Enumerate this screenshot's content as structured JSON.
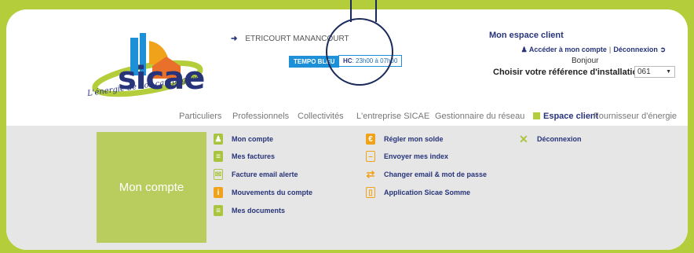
{
  "logo": {
    "brand": "sicae",
    "tagline": "L'énergie de nos campagnes"
  },
  "header": {
    "location": "ETRICOURT MANANCOURT",
    "tempo_badge": "TEMPO BLEU",
    "hc_label": "HC",
    "hc_hours": ": 23h00 à 07h00",
    "espace_title": "Mon espace client",
    "acceder_label": "Accéder à mon compte",
    "deconnexion_label": "Déconnexion",
    "bonjour": "Bonjour",
    "choisir_label": "Choisir votre référence d'installation :",
    "installation_ref": "061"
  },
  "nav": {
    "items": [
      "Particuliers",
      "Professionnels",
      "Collectivités",
      "L'entreprise SICAE",
      "Gestionnaire du réseau",
      "Espace client",
      "Fournisseur d'énergie"
    ]
  },
  "account_menu": {
    "title": "Mon compte",
    "col1": [
      "Mon compte",
      "Mes factures",
      "Facture email alerte",
      "Mouvements du compte",
      "Mes documents"
    ],
    "col2": [
      "Régler mon solde",
      "Envoyer mes index",
      "Changer email & mot de passe",
      "Application Sicae Somme"
    ],
    "col3": [
      "Déconnexion"
    ]
  },
  "colors": {
    "brand_green": "#b4cd3a",
    "brand_navy": "#27347a",
    "tempo_blue": "#1e90d8",
    "accent_orange": "#f1a21b"
  }
}
